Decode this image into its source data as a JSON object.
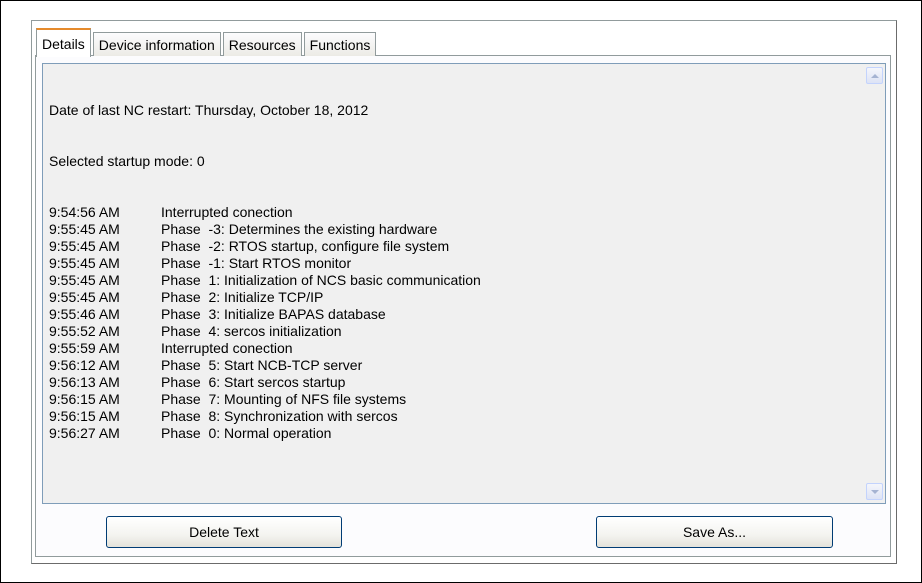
{
  "tabs": [
    {
      "label": "Details",
      "active": true
    },
    {
      "label": "Device information",
      "active": false
    },
    {
      "label": "Resources",
      "active": false
    },
    {
      "label": "Functions",
      "active": false
    }
  ],
  "log": {
    "header_lines": [
      "Date of last NC restart: Thursday, October 18, 2012",
      "Selected startup mode: 0"
    ],
    "entries": [
      {
        "time": "9:54:56 AM",
        "message": "Interrupted conection"
      },
      {
        "time": "9:55:45 AM",
        "message": "Phase  -3: Determines the existing hardware"
      },
      {
        "time": "9:55:45 AM",
        "message": "Phase  -2: RTOS startup, configure file system"
      },
      {
        "time": "9:55:45 AM",
        "message": "Phase  -1: Start RTOS monitor"
      },
      {
        "time": "9:55:45 AM",
        "message": "Phase  1: Initialization of NCS basic communication"
      },
      {
        "time": "9:55:45 AM",
        "message": "Phase  2: Initialize TCP/IP"
      },
      {
        "time": "9:55:46 AM",
        "message": "Phase  3: Initialize BAPAS database"
      },
      {
        "time": "9:55:52 AM",
        "message": "Phase  4: sercos initialization"
      },
      {
        "time": "9:55:59 AM",
        "message": "Interrupted conection"
      },
      {
        "time": "9:56:12 AM",
        "message": "Phase  5: Start NCB-TCP server"
      },
      {
        "time": "9:56:13 AM",
        "message": "Phase  6: Start sercos startup"
      },
      {
        "time": "9:56:15 AM",
        "message": "Phase  7: Mounting of NFS file systems"
      },
      {
        "time": "9:56:15 AM",
        "message": "Phase  8: Synchronization with sercos"
      },
      {
        "time": "9:56:27 AM",
        "message": "Phase  0: Normal operation"
      }
    ]
  },
  "buttons": {
    "delete_label": "Delete Text",
    "save_label": "Save As..."
  },
  "icons": {
    "scroll_up": "scroll-up-arrow-icon",
    "scroll_down": "scroll-down-arrow-icon"
  },
  "colors": {
    "active_tab_accent": "#e68b2c",
    "log_background": "#f0f0f0",
    "button_border": "#003c74"
  }
}
